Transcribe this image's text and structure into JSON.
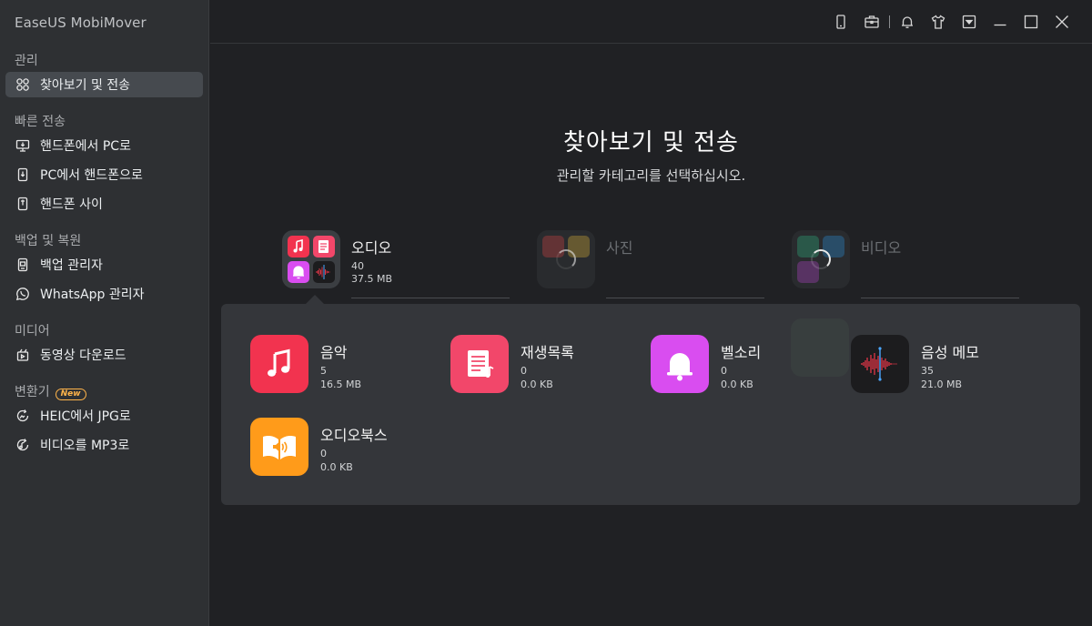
{
  "app": {
    "title": "EaseUS MobiMover"
  },
  "sidebar": {
    "sections": [
      {
        "label": "관리"
      },
      {
        "label": "빠른 전송"
      },
      {
        "label": "백업 및 복원"
      },
      {
        "label": "미디어"
      },
      {
        "label": "변환기",
        "badge": "New"
      }
    ],
    "items": [
      {
        "label": "찾아보기 및 전송",
        "icon": "grid-icon"
      },
      {
        "label": "핸드폰에서 PC로",
        "icon": "phone-to-pc-icon"
      },
      {
        "label": "PC에서 핸드폰으로",
        "icon": "pc-to-phone-icon"
      },
      {
        "label": "핸드폰 사이",
        "icon": "phone-to-phone-icon"
      },
      {
        "label": "백업 관리자",
        "icon": "backup-icon"
      },
      {
        "label": "WhatsApp 관리자",
        "icon": "whatsapp-icon"
      },
      {
        "label": "동영상 다운로드",
        "icon": "video-download-icon"
      },
      {
        "label": "HEIC에서 JPG로",
        "icon": "convert-image-icon"
      },
      {
        "label": "비디오를 MP3로",
        "icon": "convert-audio-icon"
      }
    ]
  },
  "main": {
    "title": "찾아보기 및 전송",
    "subtitle": "관리할 카테고리를 선택하십시오.",
    "categories": [
      {
        "name": "오디오",
        "count": "40",
        "size": "37.5 MB"
      },
      {
        "name": "사진"
      },
      {
        "name": "비디오"
      }
    ],
    "audio_sub": [
      {
        "name": "음악",
        "count": "5",
        "size": "16.5 MB",
        "color": "#f2334f"
      },
      {
        "name": "재생목록",
        "count": "0",
        "size": "0.0 KB",
        "color": "#f2476a"
      },
      {
        "name": "벨소리",
        "count": "0",
        "size": "0.0 KB",
        "color": "#d94df0"
      },
      {
        "name": "음성 메모",
        "count": "35",
        "size": "21.0 MB",
        "color": "#1c1c1e"
      },
      {
        "name": "오디오북스",
        "count": "0",
        "size": "0.0 KB",
        "color": "#ff9b1a"
      }
    ]
  }
}
